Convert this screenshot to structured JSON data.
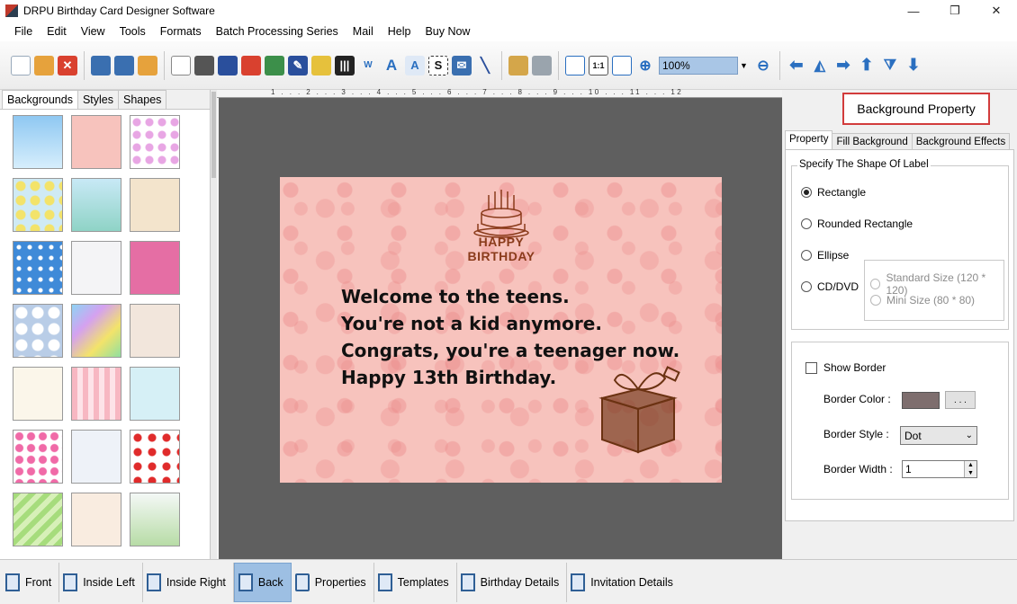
{
  "window": {
    "title": "DRPU Birthday Card Designer Software",
    "minimize": "—",
    "restore": "❐",
    "close": "✕"
  },
  "menu": [
    "File",
    "Edit",
    "View",
    "Tools",
    "Formats",
    "Batch Processing Series",
    "Mail",
    "Help",
    "Buy Now"
  ],
  "toolbar": {
    "zoom_value": "100%"
  },
  "left_tabs": [
    "Backgrounds",
    "Styles",
    "Shapes"
  ],
  "ruler": {
    "labels": "1 . . . 2 . . . 3 . . . 4 . . . 5 . . . 6 . . . 7 . . . 8 . . . 9 . . . 10 . . . 11 . . . 12"
  },
  "card": {
    "header_text": "HAPPY BIRTHDAY",
    "lines": [
      "Welcome to the teens.",
      "You're not a kid anymore.",
      "Congrats, you're a teenager now.",
      "Happy 13th Birthday."
    ]
  },
  "right_panel": {
    "title": "Background Property",
    "tabs": [
      "Property",
      "Fill Background",
      "Background Effects"
    ],
    "shape_group_title": "Specify The Shape Of Label",
    "shapes": {
      "rectangle": "Rectangle",
      "rounded": "Rounded Rectangle",
      "ellipse": "Ellipse",
      "cd": "CD/DVD"
    },
    "cd_sizes": {
      "standard": "Standard Size (120 * 120)",
      "mini": "Mini Size (80 * 80)"
    },
    "show_border": "Show Border",
    "border_color_label": "Border Color :",
    "border_color_value": "#7e6e6e",
    "ellipsis_button": ". . .",
    "border_style_label": "Border Style :",
    "border_style_value": "Dot",
    "border_width_label": "Border Width :",
    "border_width_value": "1"
  },
  "bottom_bar": [
    "Front",
    "Inside Left",
    "Inside Right",
    "Back",
    "Properties",
    "Templates",
    "Birthday Details",
    "Invitation Details"
  ]
}
